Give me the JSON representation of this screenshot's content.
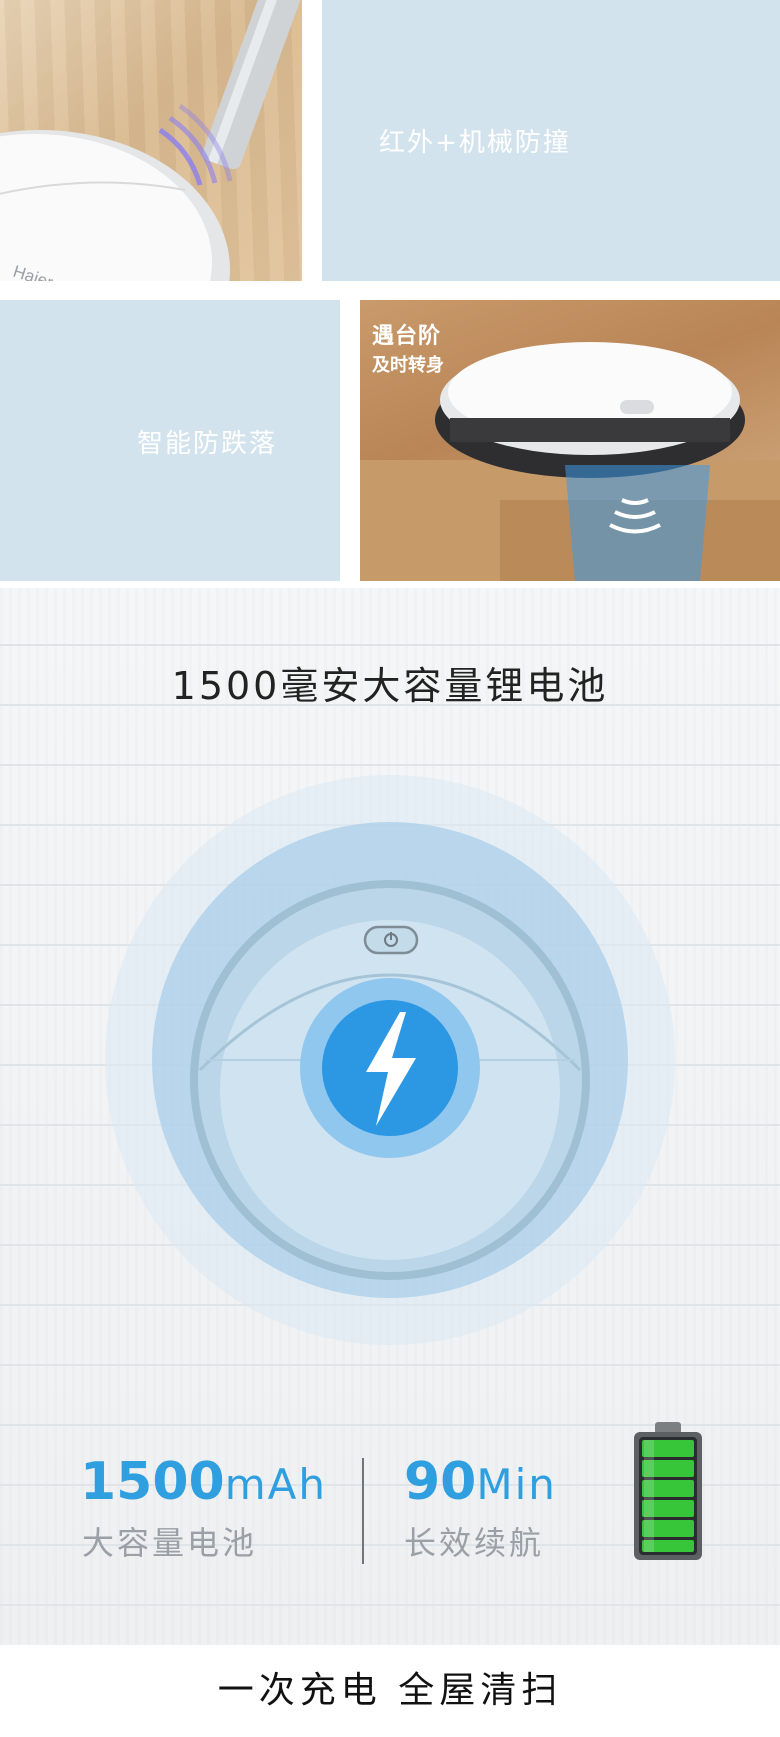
{
  "colors": {
    "tile_blue": "#d3e3ee",
    "accent_blue": "#2f9fe0",
    "battery_green": "#37c53a",
    "wood": "#dcbc92"
  },
  "features": {
    "collision": {
      "label": "红外+机械防撞"
    },
    "anti_fall": {
      "label": "智能防跌落"
    },
    "stairs": {
      "title": "遇台阶",
      "subtitle": "及时转身"
    },
    "logo_text": "Haier"
  },
  "battery_section": {
    "title": "1500毫安大容量锂电池",
    "capacity": {
      "value": "1500",
      "unit": "mAh",
      "label": "大容量电池"
    },
    "runtime": {
      "value": "90",
      "unit": "Min",
      "label": "长效续航"
    },
    "battery_icon": "battery-full-icon",
    "bolt_icon": "lightning-bolt-icon",
    "power_icon": "power-icon",
    "charge_level": 1.0
  },
  "footer": {
    "slogan": "一次充电  全屋清扫"
  }
}
